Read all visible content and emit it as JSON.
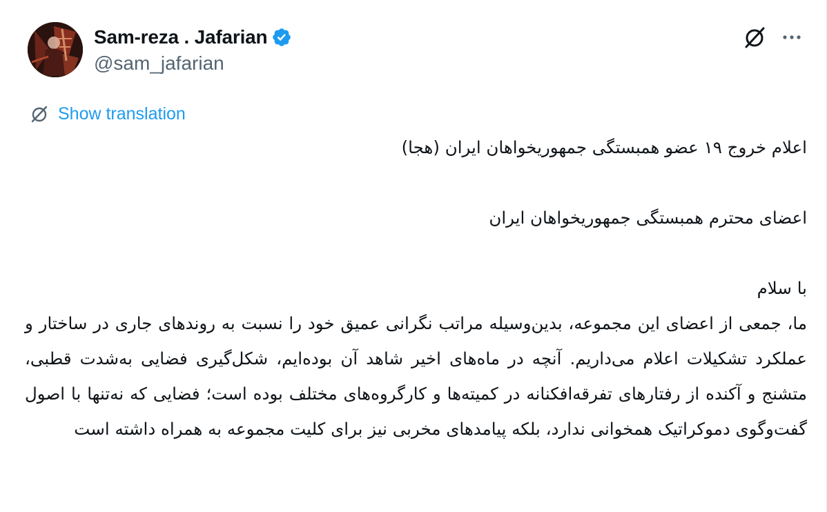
{
  "author": {
    "display_name": "Sam-reza . Jafarian",
    "handle": "@sam_jafarian",
    "verified": true,
    "avatar_icon": "profile-avatar"
  },
  "actions": {
    "grok_icon": "grok-icon",
    "more_icon": "more-options-icon"
  },
  "translation": {
    "icon": "translate-icon",
    "label": "Show translation",
    "color": "#1d9bf0"
  },
  "tweet": {
    "line1": "اعلام خروج ۱۹ عضو همبستگی جمهوریخواهان ایران (هجا)",
    "line2": "اعضای محترم همبستگی جمهوریخواهان ایران",
    "line3": "با سلام",
    "paragraph": "ما، جمعی از اعضای این مجموعه، بدین‌وسیله مراتب نگرانی عمیق خود را نسبت به روندهای جاری در ساختار و عملکرد تشکیلات اعلام می‌داریم. آنچه در ماه‌های اخیر شاهد آن بوده‌ایم، شکل‌گیری فضایی به‌شدت قطبی، متشنج و آکنده از رفتارهای تفرقه‌افکنانه در کمیته‌ها و کارگروه‌های مختلف بوده است؛ فضایی که نه‌تنها با اصول گفت‌وگوی دموکراتیک همخوانی ندارد، بلکه پیامدهای مخربی نیز برای کلیت مجموعه به همراه داشته است"
  },
  "colors": {
    "text_primary": "#0f1419",
    "text_secondary": "#536471",
    "verified_badge": "#1d9bf0"
  }
}
